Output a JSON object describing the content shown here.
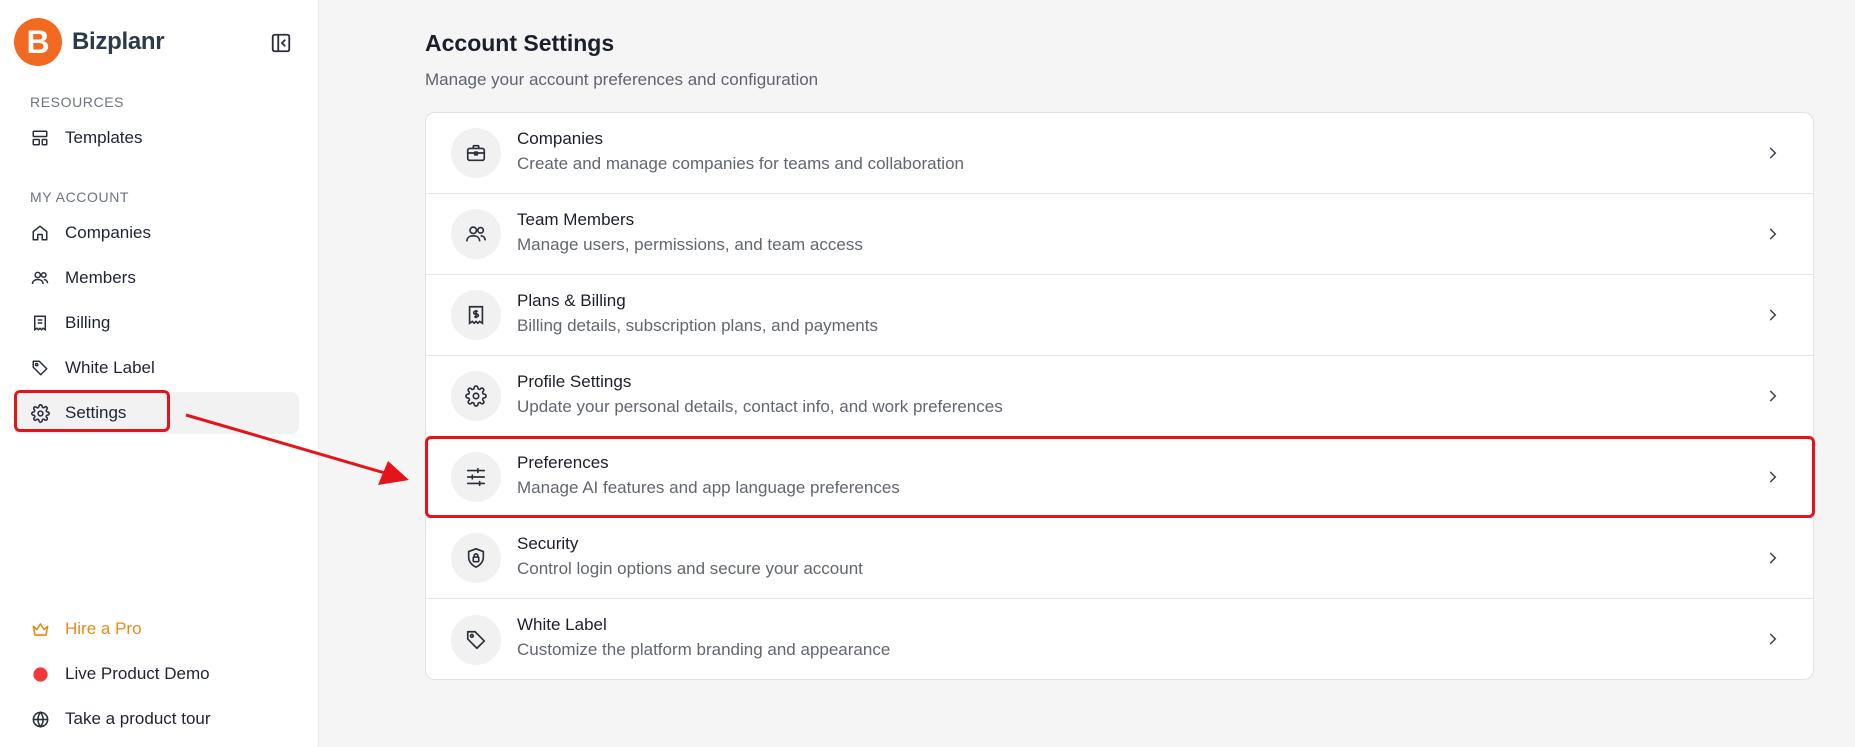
{
  "brand": {
    "name": "Bizplanr",
    "logo_letter": "B",
    "logo_color": "#f26a21"
  },
  "sidebar": {
    "resources_label": "RESOURCES",
    "my_account_label": "MY ACCOUNT",
    "items": [
      {
        "label": "Templates",
        "icon": "layout-template-icon"
      },
      {
        "label": "Companies",
        "icon": "home-icon"
      },
      {
        "label": "Members",
        "icon": "users-icon"
      },
      {
        "label": "Billing",
        "icon": "receipt-icon"
      },
      {
        "label": "White Label",
        "icon": "tag-icon"
      },
      {
        "label": "Settings",
        "icon": "gear-icon",
        "active": true
      }
    ],
    "footer": [
      {
        "label": "Hire a Pro",
        "icon": "crown-icon",
        "color": "#e8891a"
      },
      {
        "label": "Live Product Demo",
        "icon": "red-dot-icon",
        "color": "#ef3b3b"
      },
      {
        "label": "Take a product tour",
        "icon": "globe-icon"
      }
    ]
  },
  "main": {
    "title": "Account Settings",
    "subtitle": "Manage your account preferences and configuration",
    "rows": [
      {
        "title": "Companies",
        "desc": "Create and manage companies for teams and collaboration",
        "icon": "briefcase-icon"
      },
      {
        "title": "Team Members",
        "desc": "Manage users, permissions, and team access",
        "icon": "users-icon"
      },
      {
        "title": "Plans & Billing",
        "desc": "Billing details, subscription plans, and payments",
        "icon": "receipt-icon"
      },
      {
        "title": "Profile Settings",
        "desc": "Update your personal details, contact info, and work preferences",
        "icon": "gear-icon"
      },
      {
        "title": "Preferences",
        "desc": "Manage AI features and app language preferences",
        "icon": "sliders-icon",
        "highlighted": true
      },
      {
        "title": "Security",
        "desc": "Control login options and secure your account",
        "icon": "shield-icon"
      },
      {
        "title": "White Label",
        "desc": "Customize the platform branding and appearance",
        "icon": "tag-icon"
      }
    ]
  },
  "annotation_color": "#e3151a"
}
